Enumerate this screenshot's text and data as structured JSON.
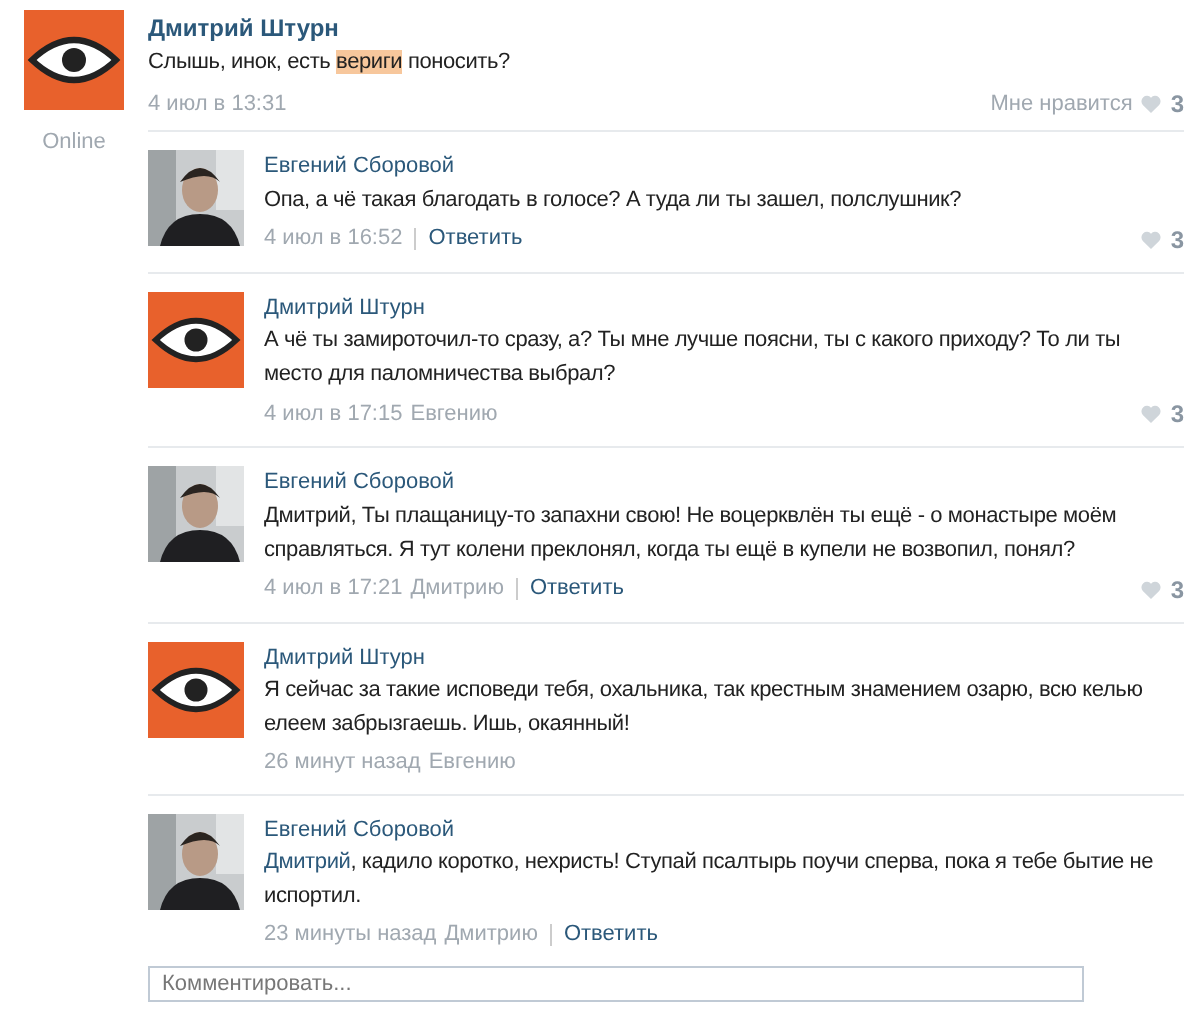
{
  "post": {
    "author": "Дмитрий Штурн",
    "kind": "eye",
    "status": "Online",
    "message": [
      {
        "kind": "plain",
        "text": "Слышь, инок, есть "
      },
      {
        "kind": "highlight",
        "text": "вериги"
      },
      {
        "kind": "plain",
        "text": " поносить?"
      }
    ],
    "date": "4 июл в 13:31",
    "like_label": "Мне нравится",
    "likes": "3"
  },
  "replies": [
    {
      "author": "Евгений Сборовой",
      "message": [
        {
          "kind": "plain",
          "text": "Опа, а чё такая благодать в голосе? А туда ли ты зашел, полслушник?"
        }
      ],
      "date": "4 июл в 16:52",
      "reply_link": "Ответить",
      "likes": "3"
    },
    {
      "author": "Дмитрий Штурн",
      "kind": "eye",
      "message": [
        {
          "kind": "plain",
          "text": "А чё ты замироточил-то сразу, а? Ты мне лучше поясни, ты с какого приходу? То ли ты место для паломничества выбрал?"
        }
      ],
      "date": "4 июл в 17:15",
      "reply_to": "Евгению",
      "likes": "3"
    },
    {
      "author": "Евгений Сборовой",
      "message": [
        {
          "kind": "plain",
          "text": "Дмитрий, Ты плащаницу-то запахни свою! Не воцерквлён ты ещё - о монастыре моём справляться. Я тут колени преклонял, когда ты ещё в купели не возвопил, понял?"
        }
      ],
      "date": "4 июл в 17:21",
      "reply_to": "Дмитрию",
      "reply_link": "Ответить",
      "likes": "3"
    },
    {
      "author": "Дмитрий Штурн",
      "kind": "eye",
      "message": [
        {
          "kind": "plain",
          "text": "Я сейчас за такие исповеди тебя, охальника, так крестным знамением озарю, всю келью елеем забрызгаешь. Ишь, окаянный!"
        }
      ],
      "date": "26 минут назад",
      "reply_to": "Евгению"
    },
    {
      "author": "Евгений Сборовой",
      "message": [
        {
          "kind": "mention",
          "text": "Дмитрий"
        },
        {
          "kind": "plain",
          "text": ", кадило коротко, нехристь! Ступай псалтырь поучи сперва, пока я тебе бытие не испортил."
        }
      ],
      "date": "23 минуты назад",
      "reply_to": "Дмитрию",
      "reply_link": "Ответить"
    }
  ],
  "comment_field": {
    "placeholder": "Комментировать..."
  }
}
